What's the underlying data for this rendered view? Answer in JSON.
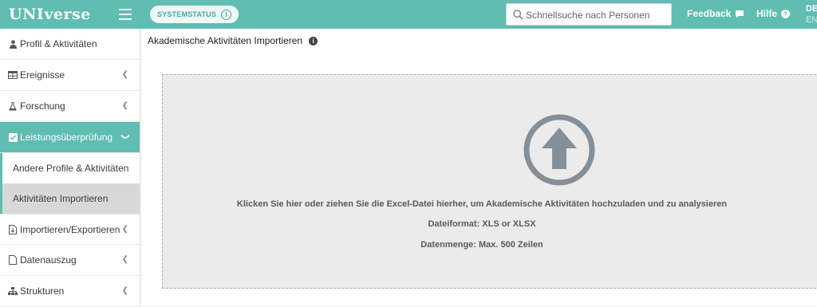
{
  "app": {
    "logo": "UNIverse"
  },
  "header": {
    "system_status": "SYSTEMSTATUS",
    "search_placeholder": "Schnellsuche nach Personen",
    "feedback": "Feedback",
    "help": "Hilfe",
    "lang_active": "DE",
    "lang_other": "EN"
  },
  "sidebar": {
    "items": [
      {
        "label": "Profil & Aktivitäten",
        "icon": "person-icon"
      },
      {
        "label": "Ereignisse",
        "icon": "table-icon"
      },
      {
        "label": "Forschung",
        "icon": "flask-icon"
      },
      {
        "label": "Leistungsüberprüfung",
        "icon": "checkbox-icon"
      },
      {
        "label": "Importieren/Exportieren",
        "icon": "file-import-icon"
      },
      {
        "label": "Datenauszug",
        "icon": "document-icon"
      },
      {
        "label": "Strukturen",
        "icon": "sitemap-icon"
      }
    ],
    "subitems": [
      {
        "label": "Andere Profile & Aktivitäten"
      },
      {
        "label": "Aktivitäten Importieren"
      }
    ]
  },
  "page": {
    "title": "Akademische Aktivitäten Importieren"
  },
  "dropzone": {
    "instruction": "Klicken Sie hier oder ziehen Sie die Excel-Datei hierher, um Akademische Aktivitäten hochzuladen und zu analysieren",
    "format": "Dateiformat: XLS or XLSX",
    "limit": "Datenmenge: Max. 500 Zeilen"
  },
  "colors": {
    "accent": "#5fbdb2",
    "dropzone_bg": "#ebebeb",
    "upload_icon": "#848f98"
  }
}
